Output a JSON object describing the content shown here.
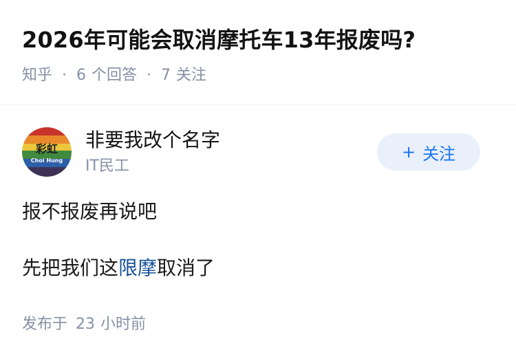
{
  "question": {
    "title": "2026年可能会取消摩托车13年报废吗?",
    "source": "知乎",
    "separator": "·",
    "answer_count": "6",
    "answer_label": "个回答",
    "follow_count": "7",
    "follow_label": "关注"
  },
  "answer": {
    "author": {
      "name": "非要我改个名字",
      "bio": "IT民工",
      "avatar_text_cn": "彩虹",
      "avatar_text_en": "Choi Hung"
    },
    "follow_button": {
      "plus": "+",
      "label": "关注"
    },
    "content": {
      "p1": "报不报废再说吧",
      "p2_before": "先把我们这",
      "p2_link": "限摩",
      "p2_after": "取消了"
    },
    "published": {
      "prefix": "发布于",
      "value": "23",
      "unit": "小时前"
    }
  },
  "colors": {
    "accent": "#1772f6",
    "link": "#175199",
    "meta_gray": "#8590a6",
    "follow_bg": "#e9f0fb"
  }
}
